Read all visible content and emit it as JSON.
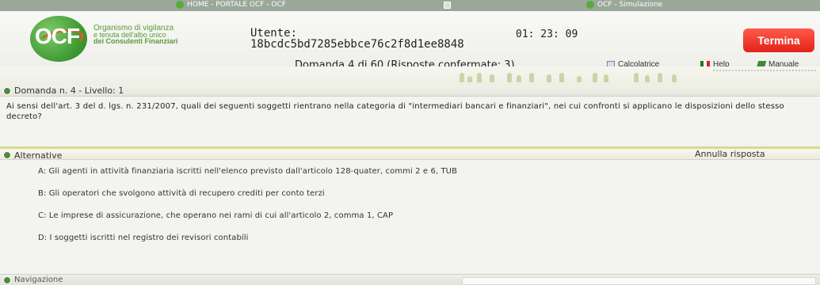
{
  "topbar": {
    "home_label": "HOME - PORTALE OCF - OCF",
    "simulation_label": "OCF - Simulazione"
  },
  "header": {
    "logo_text": "OCF",
    "org_line1": "Organismo di vigilanza",
    "org_line2": "e tenuta dell'albo unico",
    "org_line3": "dei Consulenti Finanziari",
    "user_label": "Utente:",
    "user_id": "18bcdc5bd7285ebbce76c2f8d1ee8848",
    "timer": "01: 23: 09",
    "termina_label": "Termina",
    "domanda_progress": "Domanda 4 di 60 (Risposte confermate: 3)",
    "tools": {
      "calculator": "Calcolatrice",
      "help": "Help",
      "manual": "Manuale"
    }
  },
  "question": {
    "header_label": "Domanda n. 4 - Livello: 1",
    "text": "Ai sensi dell'art. 3 del d. lgs. n. 231/2007, quali dei seguenti soggetti rientrano nella categoria di \"intermediari bancari e finanziari\", nei cui confronti si applicano le disposizioni dello stesso decreto?"
  },
  "alternatives": {
    "header_label": "Alternative",
    "annulla_label": "Annulla risposta",
    "items": [
      "A: Gli agenti in attività finanziaria iscritti nell'elenco previsto dall'articolo 128-quater, commi 2 e 6, TUB",
      "B: Gli operatori che svolgono attività di recupero crediti per conto terzi",
      "C: Le imprese di assicurazione, che operano nei rami di cui all'articolo 2, comma 1, CAP",
      "D: I soggetti iscritti nel registro dei revisori contabili"
    ]
  },
  "navigation": {
    "header_label": "Navigazione"
  },
  "colors": {
    "accent_green": "#4e8a3e",
    "termina_red": "#e2231a",
    "divider_yellow": "#d6db8c"
  }
}
